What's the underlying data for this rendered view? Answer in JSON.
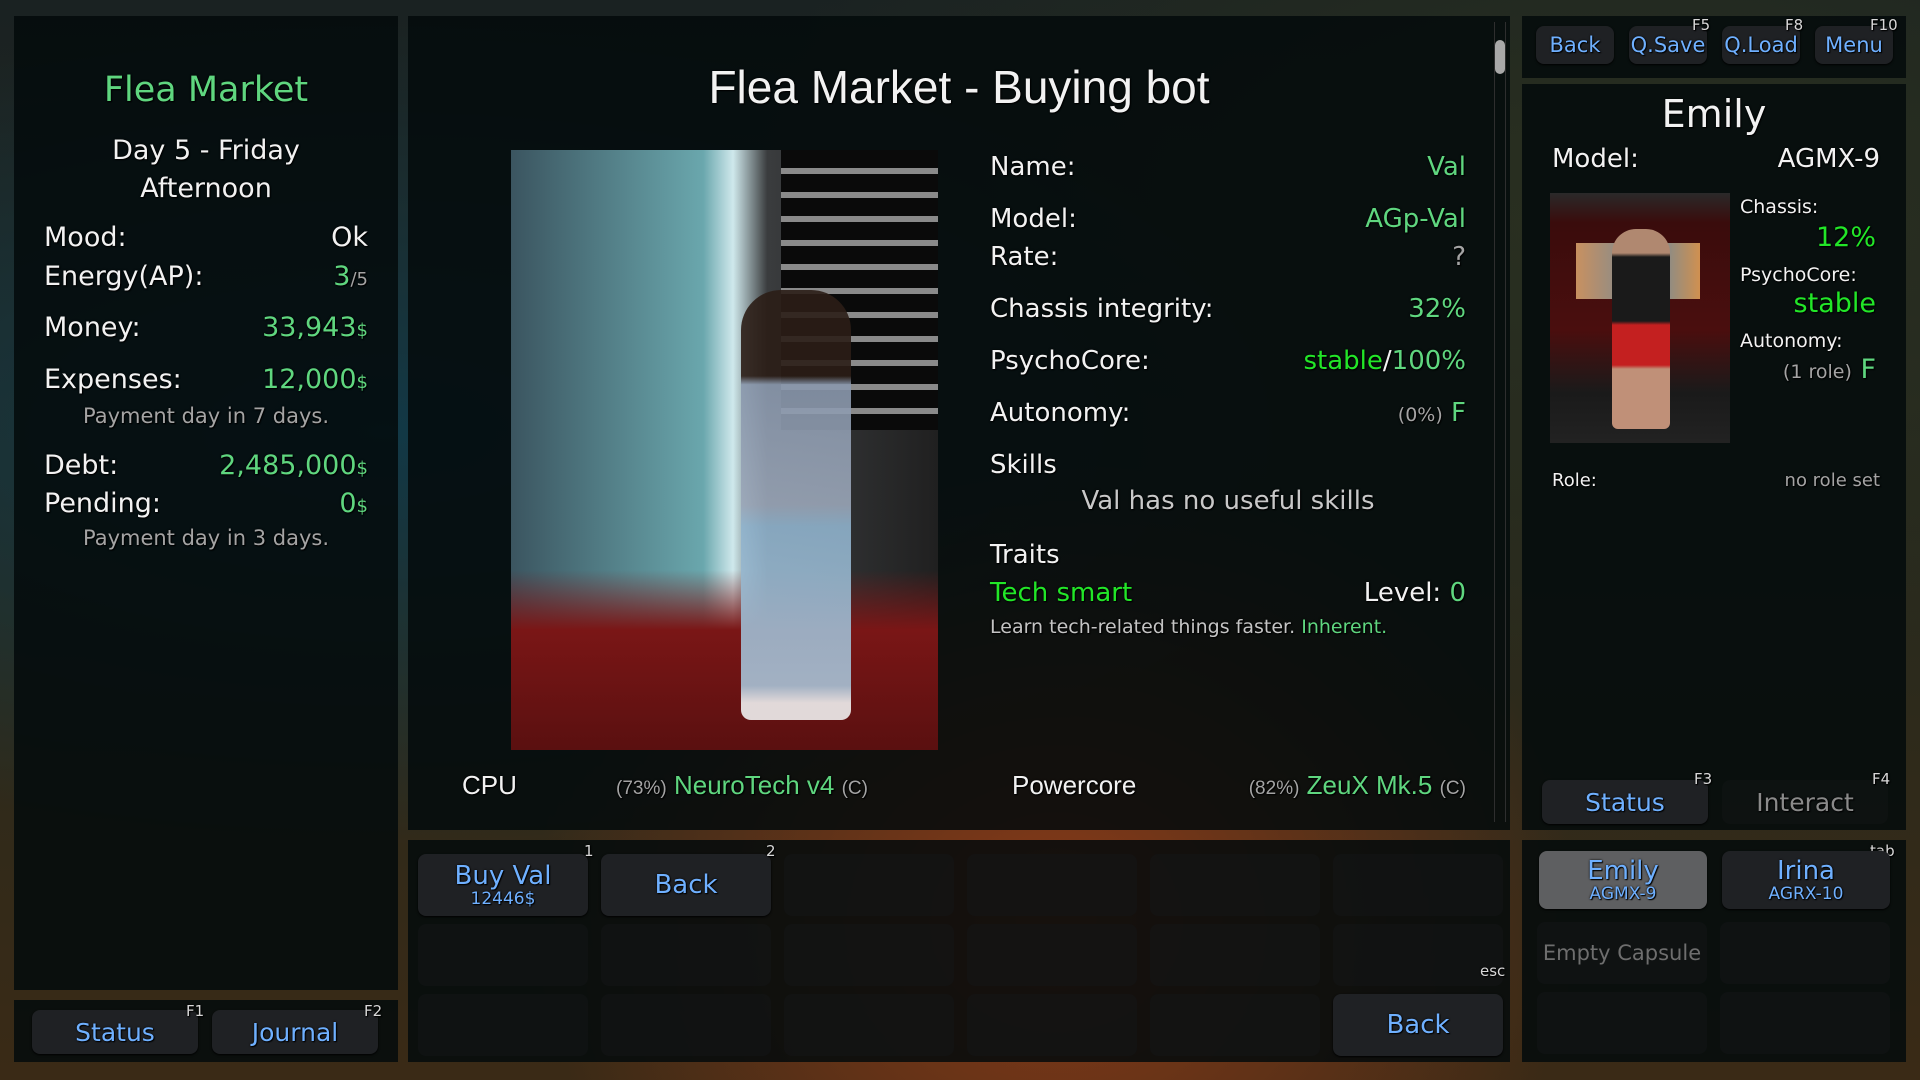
{
  "left": {
    "location": "Flea Market",
    "day": "Day 5 - Friday",
    "time_of_day": "Afternoon",
    "mood": {
      "label": "Mood:",
      "value": "Ok"
    },
    "energy": {
      "label": "Energy(AP):",
      "current": "3",
      "max": "/5"
    },
    "money": {
      "label": "Money:",
      "value": "33,943",
      "unit": "$"
    },
    "expenses": {
      "label": "Expenses:",
      "value": "12,000",
      "unit": "$",
      "note": "Payment day in 7 days."
    },
    "debt": {
      "label": "Debt:",
      "value": "2,485,000",
      "unit": "$"
    },
    "pending": {
      "label": "Pending:",
      "value": "0",
      "unit": "$",
      "note": "Payment day in 3 days."
    }
  },
  "left_bar": {
    "buttons": [
      {
        "label": "Status",
        "key": "F1"
      },
      {
        "label": "Journal",
        "key": "F2"
      }
    ]
  },
  "center": {
    "title": "Flea Market - Buying bot",
    "bot": {
      "name": {
        "label": "Name:",
        "value": "Val"
      },
      "model": {
        "label": "Model:",
        "value": "AGp-Val"
      },
      "rate": {
        "label": "Rate:",
        "value": "?"
      },
      "chassis": {
        "label": "Chassis integrity:",
        "value": "32%"
      },
      "psychocore": {
        "label": "PsychoCore:",
        "state": "stable",
        "sep": "/",
        "percent": "100%"
      },
      "autonomy": {
        "label": "Autonomy:",
        "percent": "(0%)",
        "grade": "F"
      }
    },
    "skills": {
      "heading": "Skills",
      "empty_text": "Val has no useful skills"
    },
    "traits": {
      "heading": "Traits",
      "items": [
        {
          "name": "Tech smart",
          "level_label": "Level:",
          "level": "0",
          "description": "Learn tech-related things faster.",
          "tag": "Inherent."
        }
      ]
    },
    "parts": [
      {
        "label": "CPU",
        "percent": "(73%)",
        "name": "NeuroTech v4",
        "grade": "(C)"
      },
      {
        "label": "Powercore",
        "percent": "(82%)",
        "name": "ZeuX Mk.5",
        "grade": "(C)"
      }
    ]
  },
  "actions": {
    "buy": {
      "label": "Buy Val",
      "price": "12446$",
      "key": "1"
    },
    "back": {
      "label": "Back",
      "key": "2"
    },
    "esc_back": {
      "label": "Back",
      "key": "esc"
    }
  },
  "top_bar": {
    "buttons": [
      {
        "label": "Back",
        "key": ""
      },
      {
        "label": "Q.Save",
        "key": "F5"
      },
      {
        "label": "Q.Load",
        "key": "F8"
      },
      {
        "label": "Menu",
        "key": "F10"
      }
    ]
  },
  "character": {
    "name": "Emily",
    "model_label": "Model:",
    "model": "AGMX-9",
    "chassis_label": "Chassis:",
    "chassis": "12%",
    "psychocore_label": "PsychoCore:",
    "psychocore": "stable",
    "autonomy_label": "Autonomy:",
    "autonomy_note": "(1 role)",
    "autonomy_grade": "F",
    "role_label": "Role:",
    "role": "no role set"
  },
  "tabs": [
    {
      "label": "Status",
      "key": "F3",
      "active": true
    },
    {
      "label": "Interact",
      "key": "F4",
      "active": false
    }
  ],
  "roster": {
    "tab_key": "tab",
    "bots": [
      {
        "name": "Emily",
        "model": "AGMX-9",
        "selected": true
      },
      {
        "name": "Irina",
        "model": "AGRX-10",
        "selected": false
      }
    ],
    "empty_label": "Empty Capsule"
  }
}
